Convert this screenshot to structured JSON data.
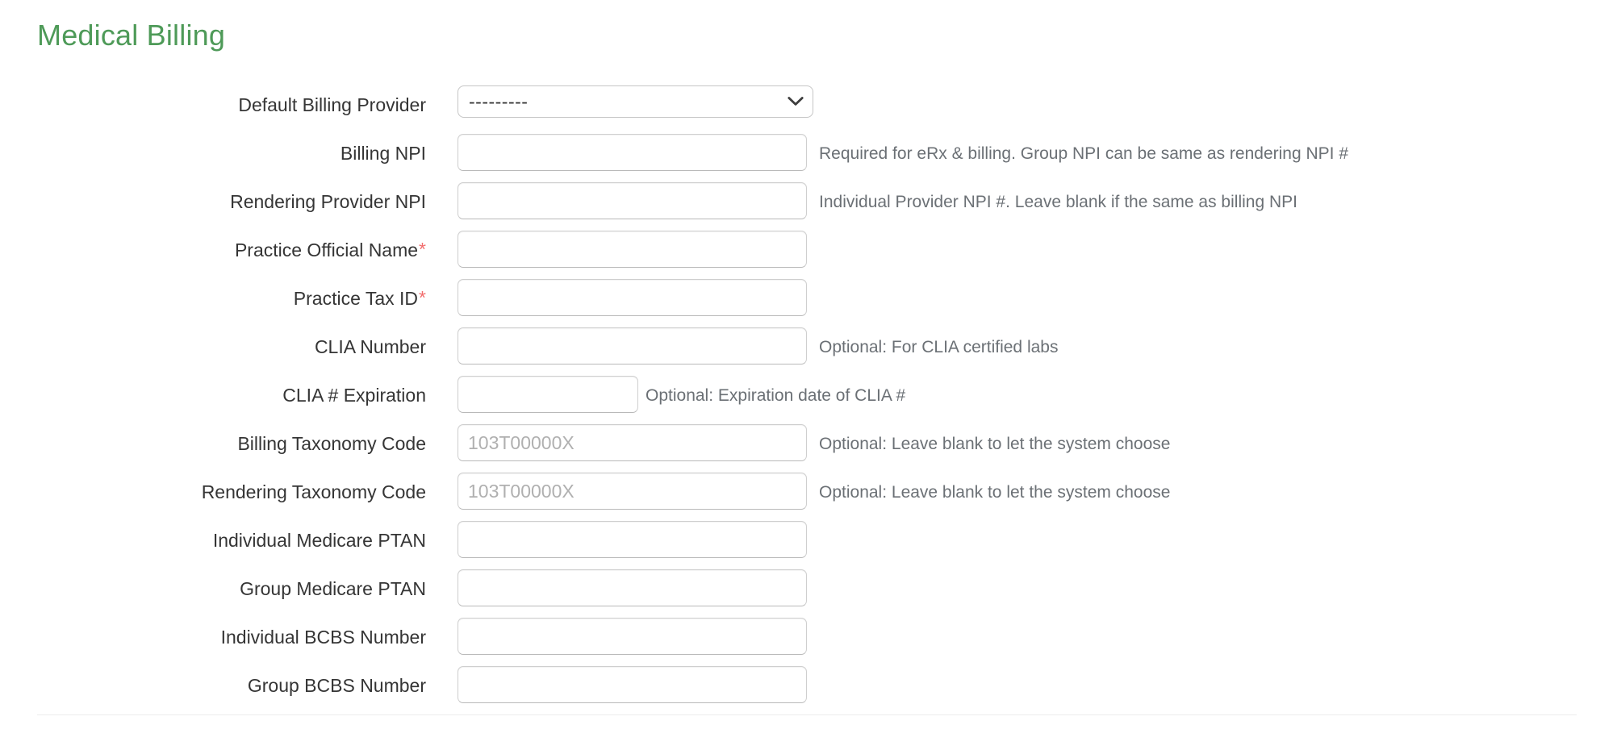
{
  "page": {
    "title": "Medical Billing",
    "title_color": "#4e9a58",
    "required_marker": "*",
    "required_marker_color": "#f26d6d"
  },
  "form": {
    "rows": [
      {
        "label": "Default Billing Provider",
        "required": false,
        "control": "select",
        "value": "---------",
        "options": [
          "---------"
        ],
        "icon": "chevron-down-icon",
        "help": ""
      },
      {
        "label": "Billing NPI",
        "required": false,
        "control": "text",
        "value": "",
        "placeholder": "",
        "help": "Required for eRx & billing. Group NPI can be same as rendering NPI #"
      },
      {
        "label": "Rendering Provider NPI",
        "required": false,
        "control": "text",
        "value": "",
        "placeholder": "",
        "help": "Individual Provider NPI #. Leave blank if the same as billing NPI"
      },
      {
        "label": "Practice Official Name",
        "required": true,
        "control": "text",
        "value": "",
        "placeholder": "",
        "help": ""
      },
      {
        "label": "Practice Tax ID",
        "required": true,
        "control": "text",
        "value": "",
        "placeholder": "",
        "help": ""
      },
      {
        "label": "CLIA Number",
        "required": false,
        "control": "text",
        "value": "",
        "placeholder": "",
        "help": "Optional: For CLIA certified labs"
      },
      {
        "label": "CLIA # Expiration",
        "required": false,
        "control": "text-narrow",
        "value": "",
        "placeholder": "",
        "help": "Optional: Expiration date of CLIA #"
      },
      {
        "label": "Billing Taxonomy Code",
        "required": false,
        "control": "text",
        "value": "",
        "placeholder": "103T00000X",
        "help": "Optional: Leave blank to let the system choose"
      },
      {
        "label": "Rendering Taxonomy Code",
        "required": false,
        "control": "text",
        "value": "",
        "placeholder": "103T00000X",
        "help": "Optional: Leave blank to let the system choose"
      },
      {
        "label": "Individual Medicare PTAN",
        "required": false,
        "control": "text",
        "value": "",
        "placeholder": "",
        "help": ""
      },
      {
        "label": "Group Medicare PTAN",
        "required": false,
        "control": "text",
        "value": "",
        "placeholder": "",
        "help": ""
      },
      {
        "label": "Individual BCBS Number",
        "required": false,
        "control": "text",
        "value": "",
        "placeholder": "",
        "help": ""
      },
      {
        "label": "Group BCBS Number",
        "required": false,
        "control": "text",
        "value": "",
        "placeholder": "",
        "help": ""
      }
    ]
  }
}
